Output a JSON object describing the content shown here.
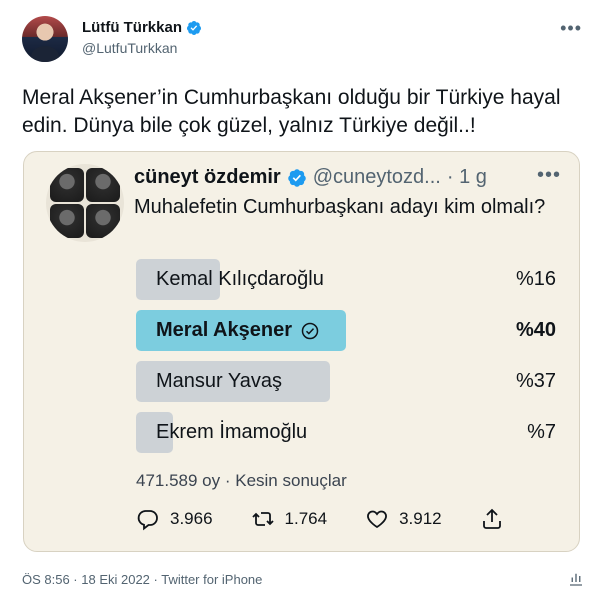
{
  "author": {
    "display_name": "Lütfü Türkkan",
    "handle": "@LutfuTurkkan",
    "verified": true
  },
  "tweet": {
    "text": "Meral Akşener’in Cumhurbaşkanı olduğu bir Türkiye hayal edin. Dünya bile çok güzel, yalnız Türkiye değil..!",
    "timestamp": "ÖS 8:56 · 18 Eki 2022 · Twitter for iPhone"
  },
  "quoted": {
    "display_name": "cüneyt özdemir",
    "handle": "@cuneytozd...",
    "time": "· 1 g",
    "question": "Muhalefetin Cumhurbaşkanı adayı kim olmalı?",
    "poll": [
      {
        "label": "Kemal Kılıçdaroğlu",
        "percent_label": "%16",
        "share": 0.16,
        "winner": false
      },
      {
        "label": "Meral Akşener",
        "percent_label": "%40",
        "share": 0.4,
        "winner": true
      },
      {
        "label": "Mansur Yavaş",
        "percent_label": "%37",
        "share": 0.37,
        "winner": false
      },
      {
        "label": "Ekrem İmamoğlu",
        "percent_label": "%7",
        "share": 0.07,
        "winner": false
      }
    ],
    "votes_summary": "471.589 oy · Kesin sonuçlar",
    "stats": {
      "replies": "3.966",
      "retweets": "1.764",
      "likes": "3.912"
    }
  },
  "icons": {
    "verified": "verified-badge-icon",
    "more": "more-icon",
    "reply": "reply-icon",
    "retweet": "retweet-icon",
    "like": "heart-icon",
    "share": "share-icon",
    "analytics": "analytics-icon"
  },
  "colors": {
    "verified": "#1d9bf0",
    "poll_winner": "#7ccddf",
    "poll_other": "#cdd2d6",
    "embed_bg": "#f5f1e6"
  }
}
